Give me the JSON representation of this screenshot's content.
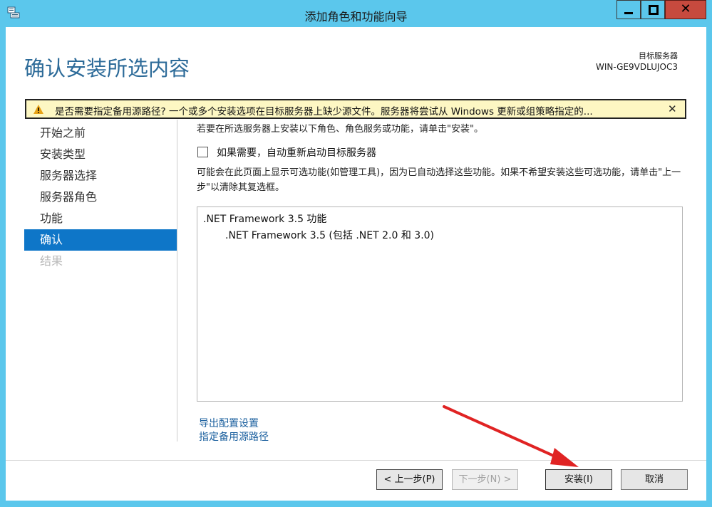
{
  "window": {
    "title": "添加角色和功能向导",
    "close_symbol": "✕"
  },
  "header": {
    "page_title": "确认安装所选内容",
    "target_label": "目标服务器",
    "target_name": "WIN-GE9VDLUJOC3"
  },
  "warning": {
    "text": "是否需要指定备用源路径? 一个或多个安装选项在目标服务器上缺少源文件。服务器将尝试从 Windows 更新或组策略指定的...",
    "close_symbol": "✕"
  },
  "nav": {
    "items": [
      {
        "label": "开始之前"
      },
      {
        "label": "安装类型"
      },
      {
        "label": "服务器选择"
      },
      {
        "label": "服务器角色"
      },
      {
        "label": "功能"
      },
      {
        "label": "确认"
      },
      {
        "label": "结果"
      }
    ]
  },
  "main": {
    "intro": "若要在所选服务器上安装以下角色、角色服务或功能，请单击\"安装\"。",
    "restart_label": "如果需要，自动重新启动目标服务器",
    "note": "可能会在此页面上显示可选功能(如管理工具)，因为已自动选择这些功能。如果不希望安装这些可选功能，请单击\"上一步\"以清除其复选框。",
    "features": [
      {
        "label": ".NET Framework 3.5 功能"
      },
      {
        "label": ".NET Framework 3.5 (包括 .NET 2.0 和 3.0)"
      }
    ],
    "links": {
      "export": "导出配置设置",
      "alt_source": "指定备用源路径"
    }
  },
  "footer": {
    "prev": "< 上一步(P)",
    "next": "下一步(N) >",
    "install": "安装(I)",
    "cancel": "取消"
  },
  "colors": {
    "titlebar": "#5bc7ec",
    "accent": "#0e76c8",
    "warning_bg": "#fdf7c3",
    "arrow": "#e02323"
  }
}
